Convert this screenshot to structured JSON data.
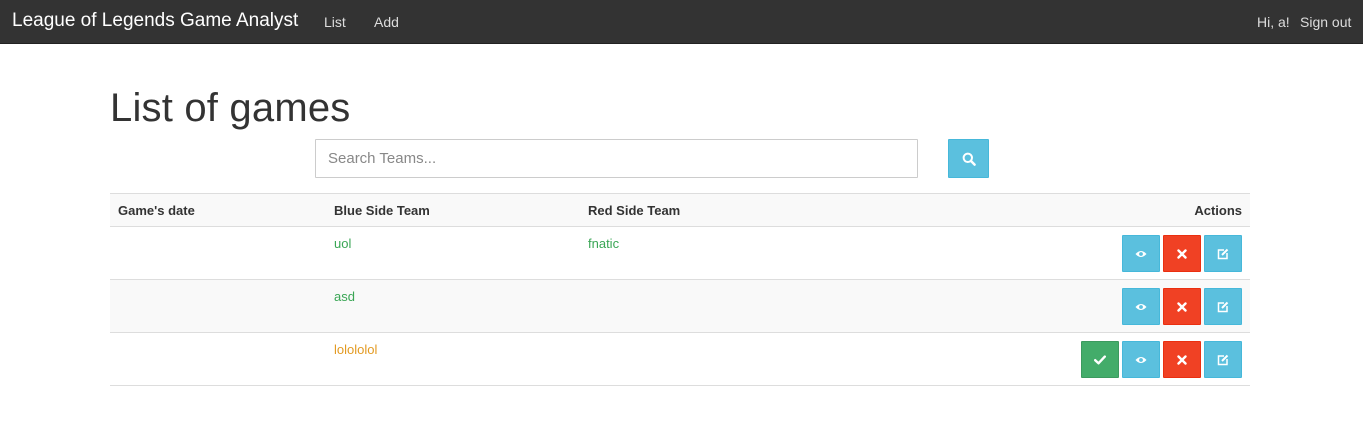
{
  "navbar": {
    "brand": "League of Legends Game Analyst",
    "links": {
      "list": "List",
      "add": "Add"
    },
    "greeting": "Hi, a!",
    "signout": "Sign out"
  },
  "page": {
    "title": "List of games"
  },
  "search": {
    "placeholder": "Search Teams...",
    "value": "",
    "button_icon": "search-icon"
  },
  "table": {
    "headers": {
      "date": "Game's date",
      "blue": "Blue Side Team",
      "red": "Red Side Team",
      "actions": "Actions"
    },
    "rows": [
      {
        "date": "",
        "blue": "uol",
        "red": "fnatic",
        "text_color": "#3aa655",
        "actions": [
          "eye-icon",
          "close-icon",
          "edit-icon"
        ]
      },
      {
        "date": "",
        "blue": "asd",
        "red": "",
        "text_color": "#3aa655",
        "actions": [
          "eye-icon",
          "close-icon",
          "edit-icon"
        ]
      },
      {
        "date": "",
        "blue": "lolololol",
        "red": "",
        "text_color": "#e39a22",
        "actions": [
          "check-icon",
          "eye-icon",
          "close-icon",
          "edit-icon"
        ]
      }
    ]
  },
  "colors": {
    "navbar_bg": "#333333",
    "info": "#5bc0de",
    "danger": "#f04124",
    "success": "#43ac6a",
    "team_green": "#3aa655",
    "team_orange": "#e39a22"
  }
}
